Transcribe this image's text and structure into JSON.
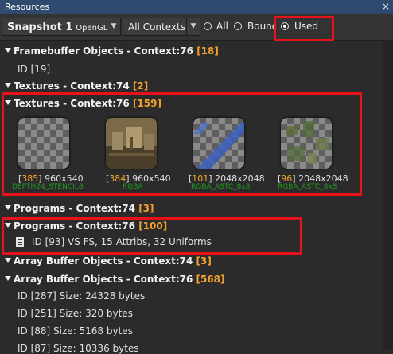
{
  "window": {
    "title": "Resources",
    "close_glyph": "×"
  },
  "toolbar": {
    "snapshot": {
      "name": "Snapshot 1",
      "api": "OpenGL",
      "dropdown_icon": "chevron-down-icon"
    },
    "context_filter": {
      "selected": "All Contexts",
      "dropdown_icon": "chevron-down-icon"
    },
    "scope": {
      "options": [
        "All",
        "Bound",
        "Used"
      ],
      "selected": "Used"
    }
  },
  "tree": [
    {
      "title": "Framebuffer Objects - Context:76",
      "count": "18",
      "items": [
        "ID [19]"
      ]
    },
    {
      "title": "Textures - Context:74",
      "count": "2"
    },
    {
      "title": "Textures - Context:76",
      "count": "159",
      "textures": [
        {
          "count": "385",
          "size": "960x540",
          "format": "DEPTH24_STENCIL8",
          "preview": "checker"
        },
        {
          "count": "384",
          "size": "960x540",
          "format": "RGBA",
          "preview": "scene"
        },
        {
          "count": "101",
          "size": "2048x2048",
          "format": "RGBA_ASTC_8x8",
          "preview": "blue-atlas"
        },
        {
          "count": "96",
          "size": "2048x2048",
          "format": "RGBA_ASTC_8x8",
          "preview": "green-atlas"
        }
      ]
    },
    {
      "title": "Programs - Context:74",
      "count": "3"
    },
    {
      "title": "Programs - Context:76",
      "count": "100",
      "items": [
        "ID [93] VS FS, 15 Attribs, 32 Uniforms"
      ]
    },
    {
      "title": "Array Buffer Objects - Context:74",
      "count": "3"
    },
    {
      "title": "Array Buffer Objects - Context:76",
      "count": "568",
      "items": [
        "ID [287] Size: 24328 bytes",
        "ID [251] Size: 320 bytes",
        "ID [88] Size: 5168 bytes",
        "ID [87] Size: 10336 bytes"
      ]
    }
  ],
  "colors": {
    "highlight": "#e8121b",
    "count": "#f3a32b",
    "format_label": "#1e9b1e"
  }
}
